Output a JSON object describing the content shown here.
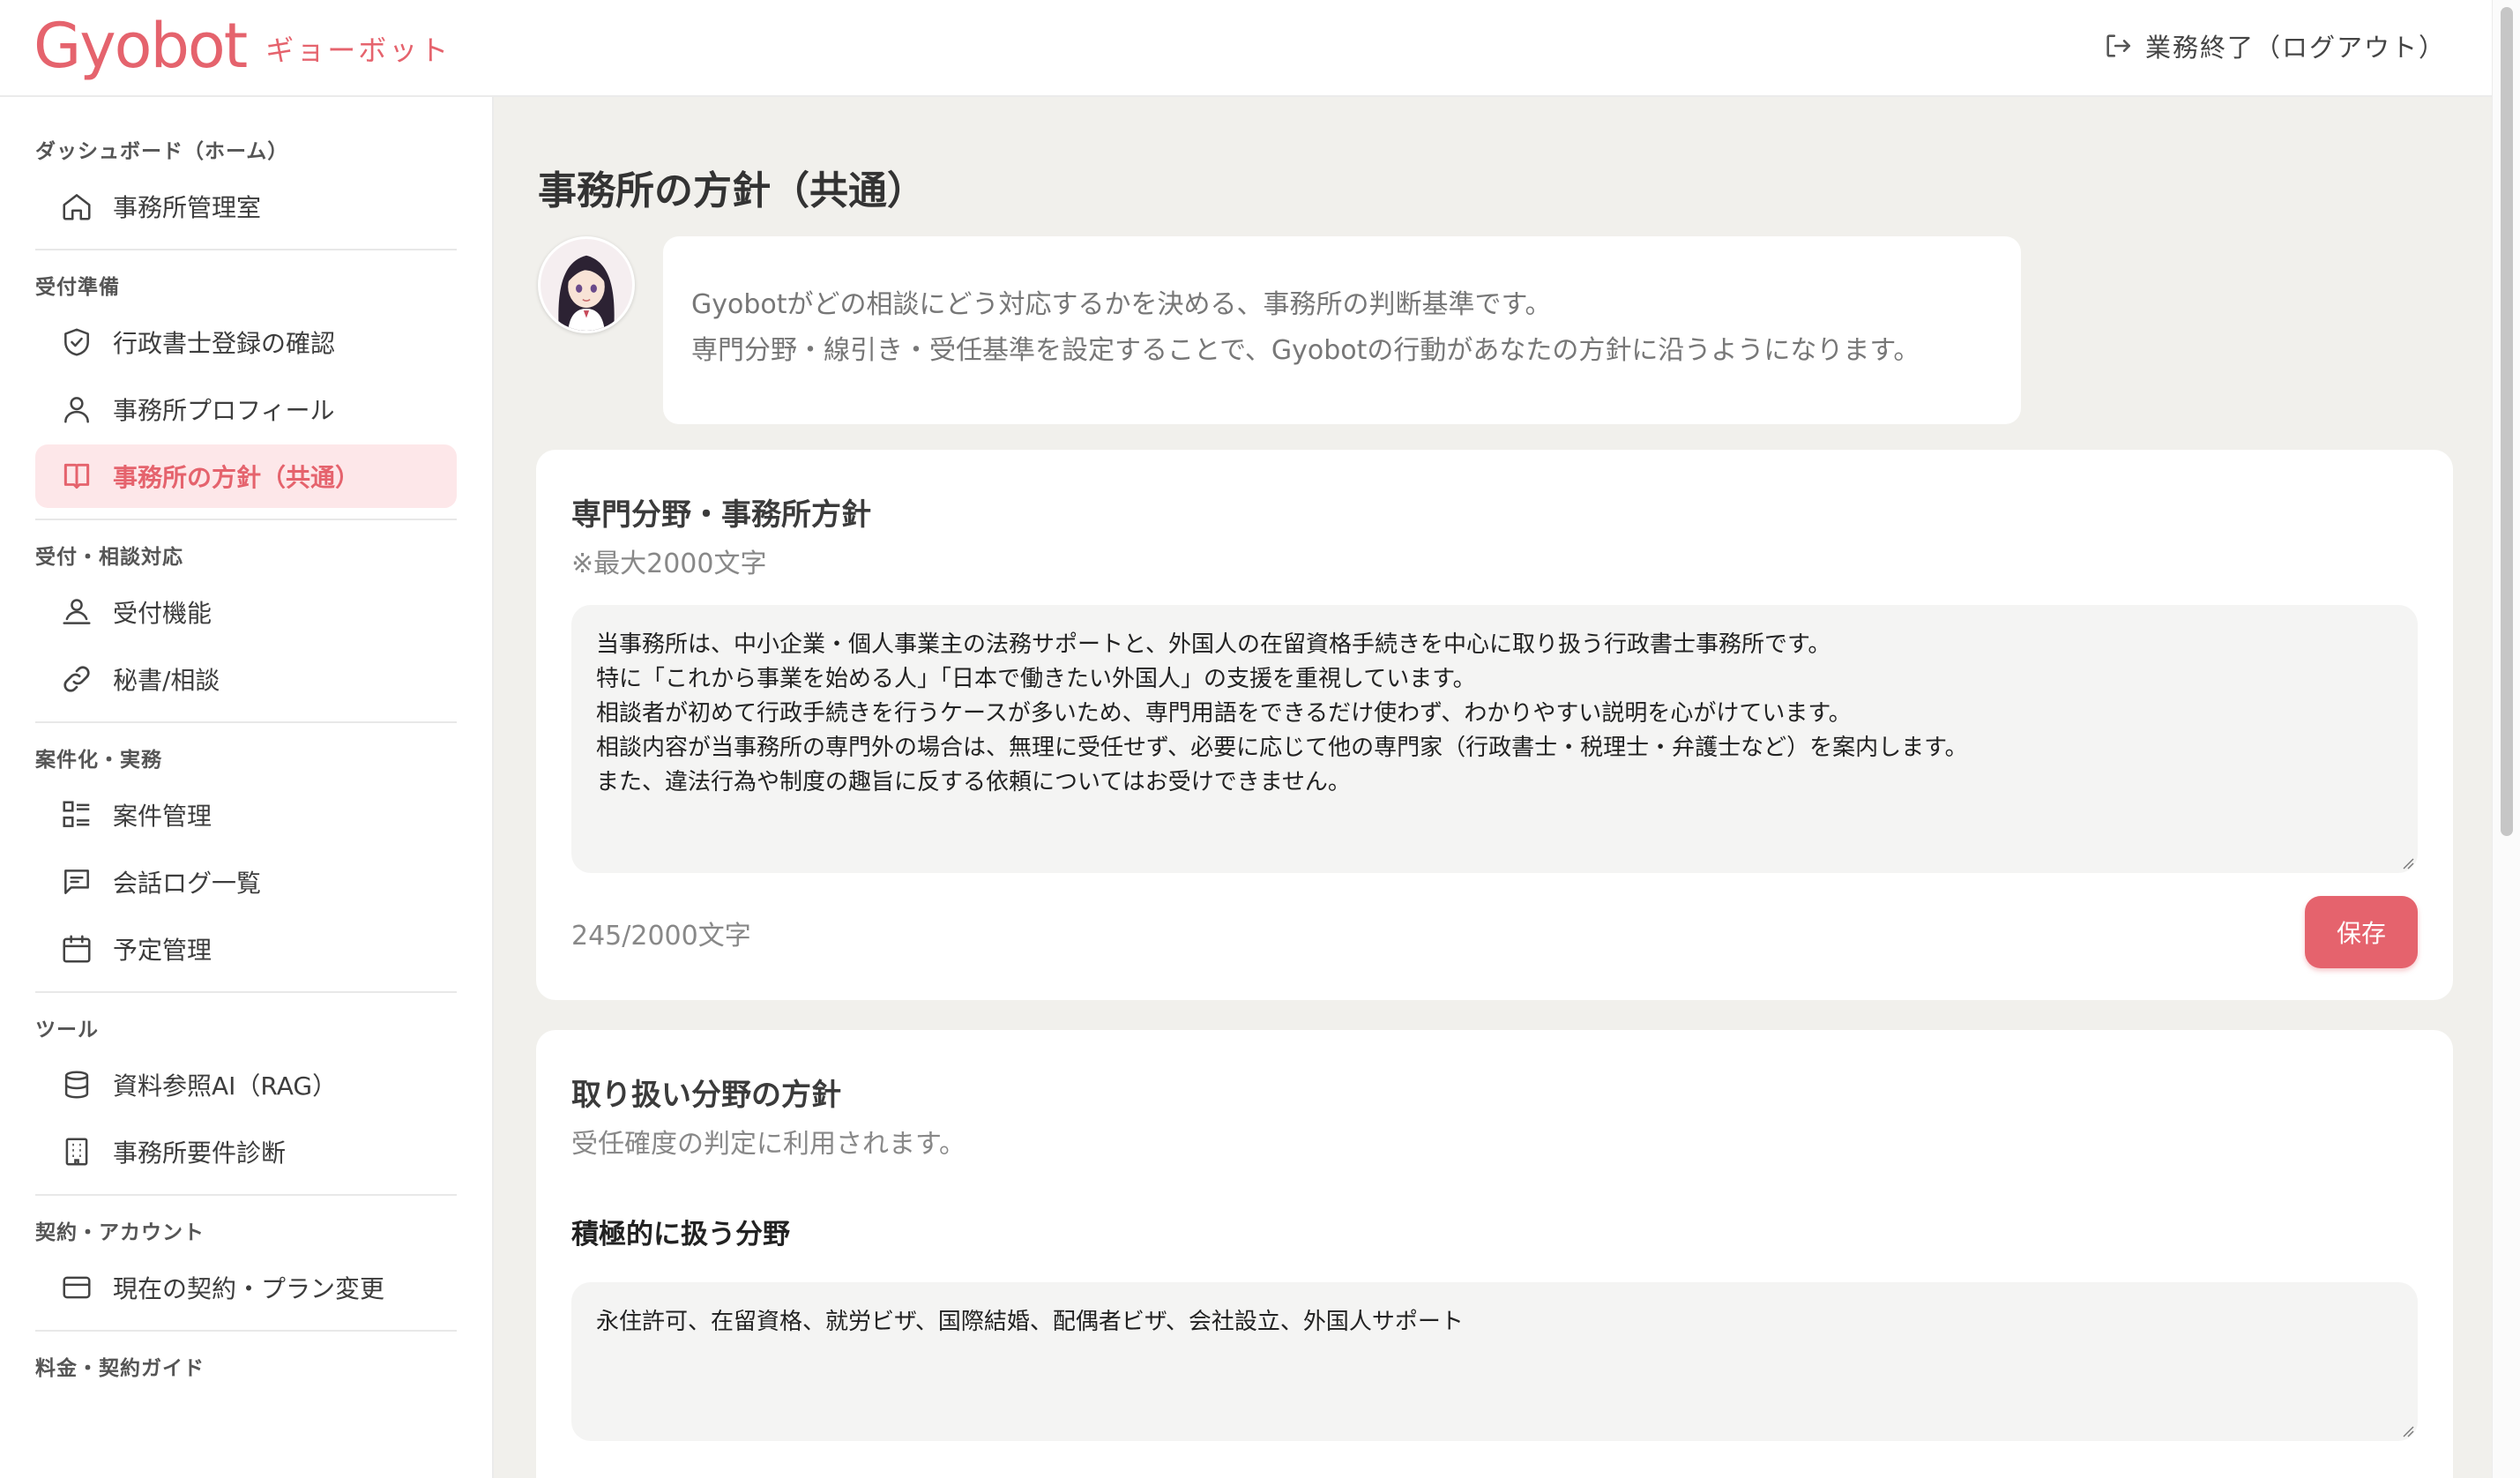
{
  "header": {
    "logo_word": "Gyobot",
    "logo_sub": "ギョーボット",
    "logout_label": "業務終了（ログアウト）"
  },
  "sidebar": {
    "groups": [
      {
        "title": "ダッシュボード（ホーム）",
        "items": [
          {
            "label": "事務所管理室",
            "icon": "home-icon"
          }
        ]
      },
      {
        "title": "受付準備",
        "items": [
          {
            "label": "行政書士登録の確認",
            "icon": "shield-check-icon"
          },
          {
            "label": "事務所プロフィール",
            "icon": "user-icon"
          },
          {
            "label": "事務所の方針（共通）",
            "icon": "book-icon",
            "active": true
          }
        ]
      },
      {
        "title": "受付・相談対応",
        "items": [
          {
            "label": "受付機能",
            "icon": "reception-icon"
          },
          {
            "label": "秘書/相談",
            "icon": "link-icon"
          }
        ]
      },
      {
        "title": "案件化・実務",
        "items": [
          {
            "label": "案件管理",
            "icon": "list-icon"
          },
          {
            "label": "会話ログ一覧",
            "icon": "chat-icon"
          },
          {
            "label": "予定管理",
            "icon": "calendar-icon"
          }
        ]
      },
      {
        "title": "ツール",
        "items": [
          {
            "label": "資料参照AI（RAG）",
            "icon": "database-icon"
          },
          {
            "label": "事務所要件診断",
            "icon": "building-icon"
          }
        ]
      },
      {
        "title": "契約・アカウント",
        "items": [
          {
            "label": "現在の契約・プラン変更",
            "icon": "credit-card-icon"
          }
        ]
      },
      {
        "title": "料金・契約ガイド",
        "items": []
      }
    ]
  },
  "main": {
    "page_title": "事務所の方針（共通）",
    "intro_lines": [
      "Gyobotがどの相談にどう対応するかを決める、事務所の判断基準です。",
      "専門分野・線引き・受任基準を設定することで、Gyobotの行動があなたの方針に沿うようになります。"
    ],
    "policy_card": {
      "title": "専門分野・事務所方針",
      "subtitle": "※最大2000文字",
      "text_lines": [
        "当事務所は、中小企業・個人事業主の法務サポートと、外国人の在留資格手続きを中心に取り扱う行政書士事務所です。",
        "特に「これから事業を始める人」「日本で働きたい外国人」の支援を重視しています。",
        "相談者が初めて行政手続きを行うケースが多いため、専門用語をできるだけ使わず、わかりやすい説明を心がけています。",
        "相談内容が当事務所の専門外の場合は、無理に受任せず、必要に応じて他の専門家（行政書士・税理士・弁護士など）を案内します。",
        "また、違法行為や制度の趣旨に反する依頼についてはお受けできません。"
      ],
      "counter": "245/2000文字",
      "save_label": "保存"
    },
    "fields_card": {
      "title": "取り扱い分野の方針",
      "subtitle": "受任確度の判定に利用されます。",
      "active_label": "積極的に扱う分野",
      "active_value": "永住許可、在留資格、就労ビザ、国際結婚、配偶者ビザ、会社設立、外国人サポート"
    }
  },
  "colors": {
    "accent": "#e5636d",
    "active_bg": "#fde7e9",
    "page_bg": "#f1f0ec"
  }
}
